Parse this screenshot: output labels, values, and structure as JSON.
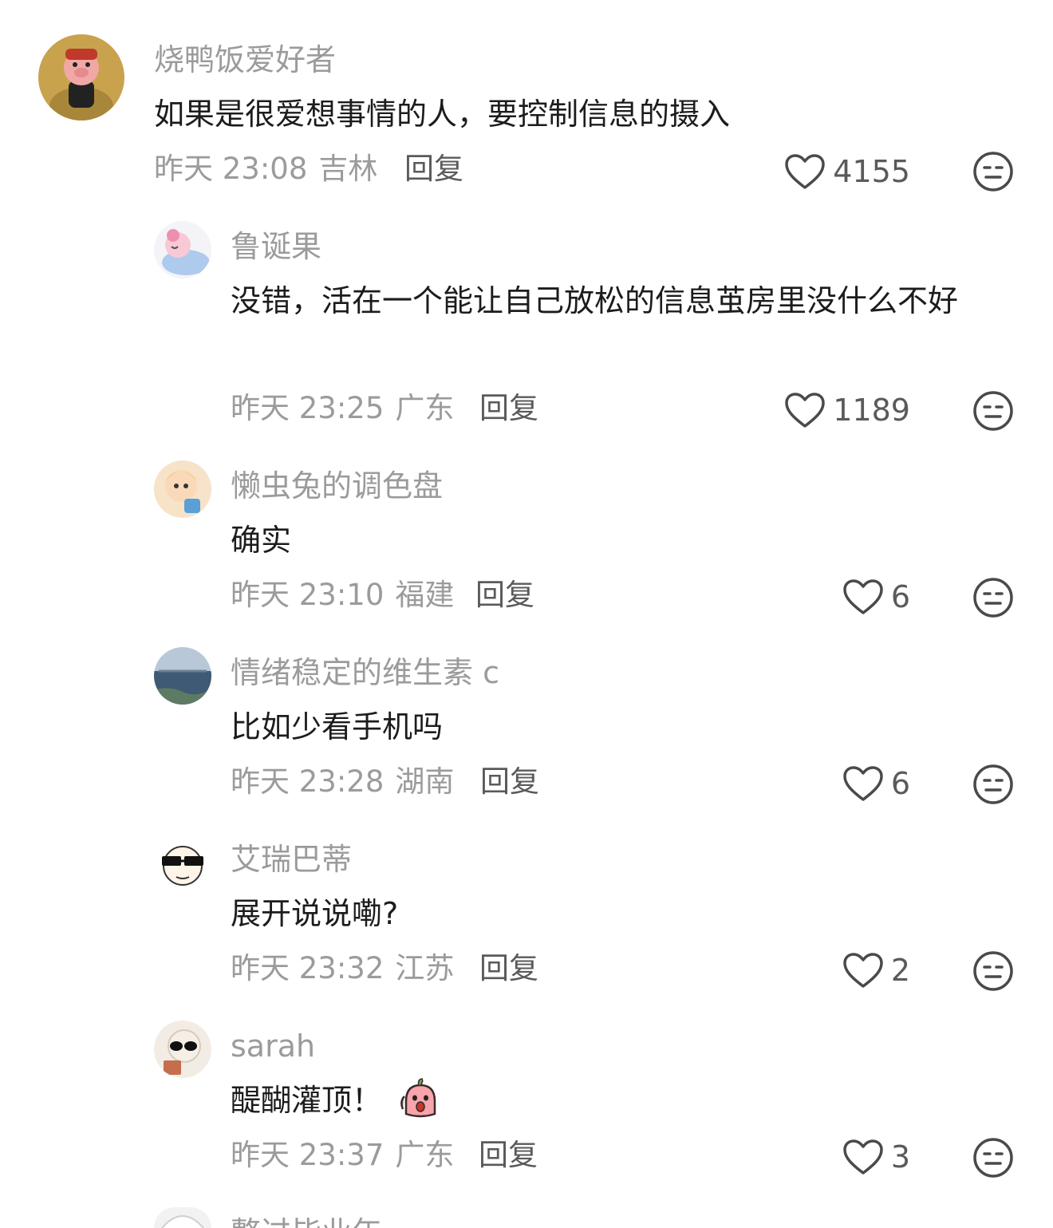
{
  "comments": [
    {
      "username": "烧鸭饭爱好者",
      "text": "如果是很爱想事情的人，要控制信息的摄入",
      "time": "昨天 23:08",
      "location": "吉林",
      "reply_label": "回复",
      "likes": "4155"
    },
    {
      "username": "鲁诞果",
      "text": "没错，活在一个能让自己放松的信息茧房里没什么不好",
      "time": "昨天 23:25",
      "location": "广东",
      "reply_label": "回复",
      "likes": "1189"
    },
    {
      "username": "懒虫兔的调色盘",
      "text": "确实",
      "time": "昨天 23:10",
      "location": "福建",
      "reply_label": "回复",
      "likes": "6"
    },
    {
      "username": "情绪稳定的维生素 c",
      "text": "比如少看手机吗",
      "time": "昨天 23:28",
      "location": "湖南",
      "reply_label": "回复",
      "likes": "6"
    },
    {
      "username": "艾瑞巴蒂",
      "text": "展开说说嘞?",
      "time": "昨天 23:32",
      "location": "江苏",
      "reply_label": "回复",
      "likes": "2"
    },
    {
      "username": "sarah",
      "text": "醍醐灌顶！",
      "time": "昨天 23:37",
      "location": "广东",
      "reply_label": "回复",
      "likes": "3",
      "inline_emoji": "shocked-face-emoji"
    },
    {
      "username": "整过毕业年",
      "partial": true
    }
  ],
  "icons": {
    "like": "heart-outline-icon",
    "dislike": "meh-face-icon"
  },
  "colors": {
    "username": "#9b9b9b",
    "text": "#1c1c1c",
    "icon": "#4a4a4a"
  }
}
